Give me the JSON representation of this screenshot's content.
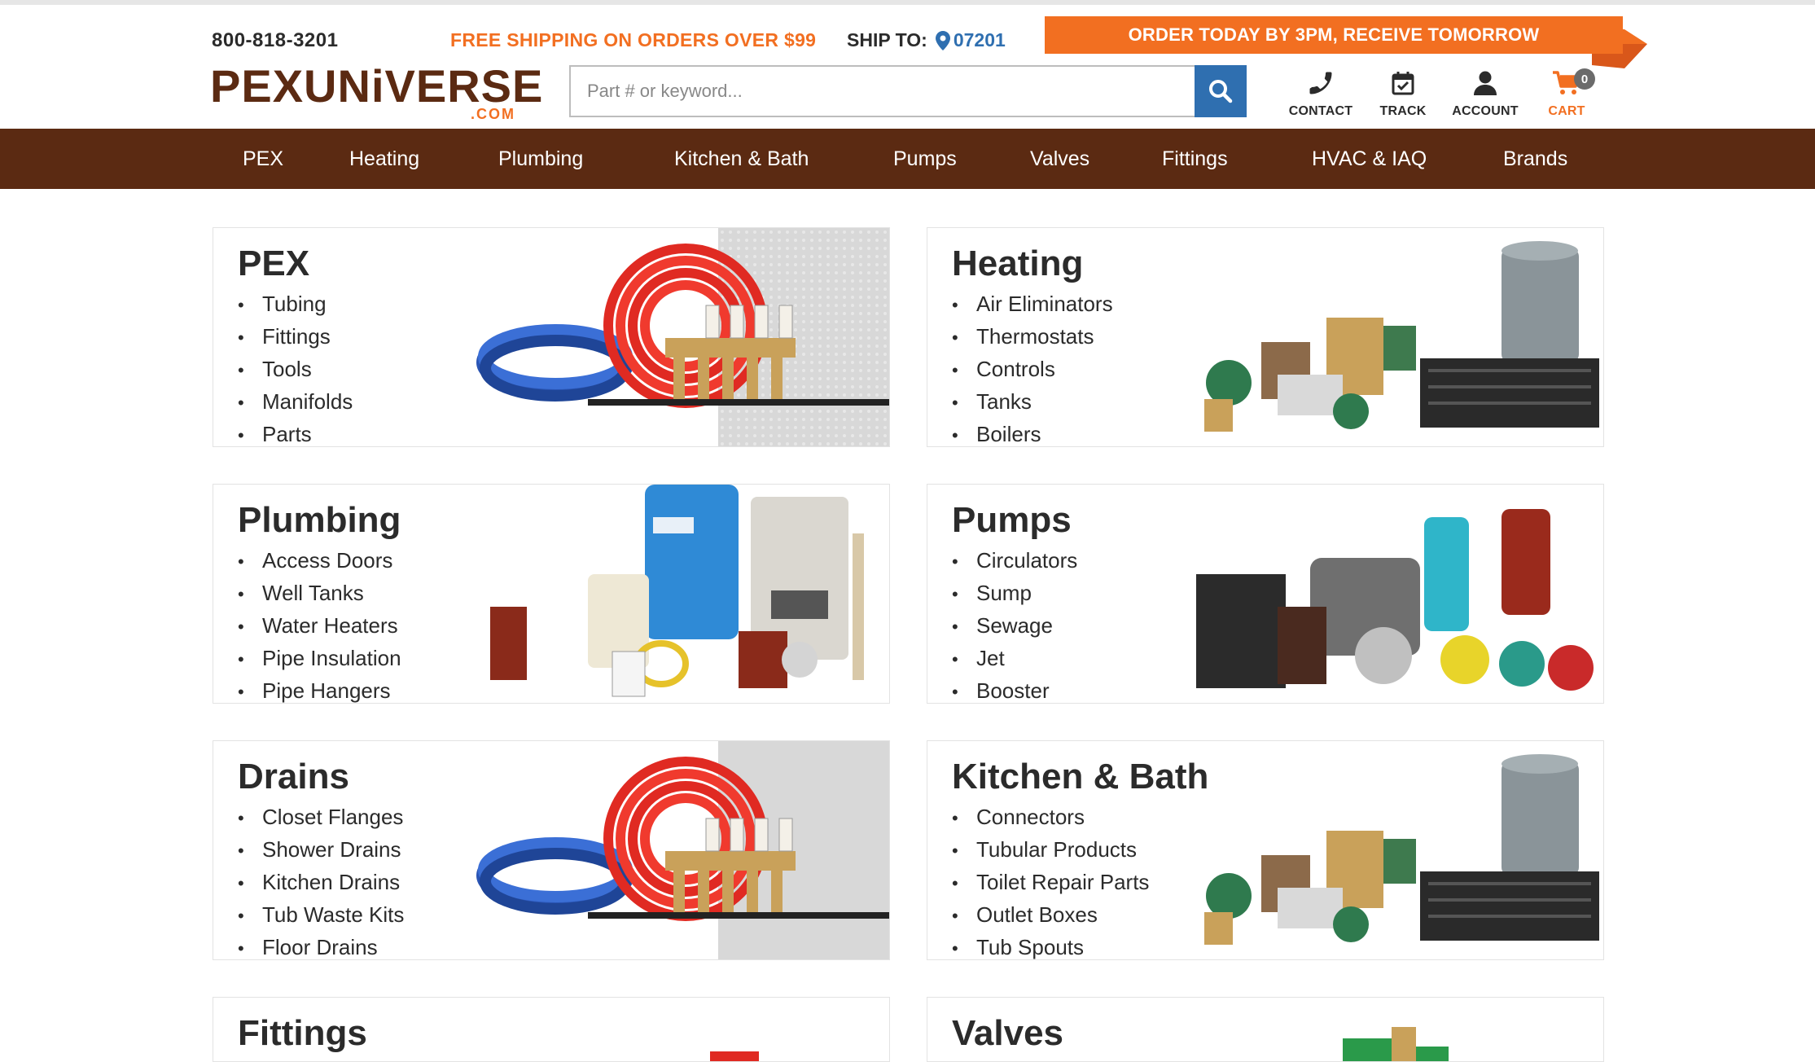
{
  "header": {
    "phone": "800-818-3201",
    "free_shipping": "FREE SHIPPING ON ORDERS OVER $99",
    "ship_to_label": "SHIP TO:",
    "ship_to_zip": "07201",
    "order_banner": "ORDER TODAY BY 3PM, RECEIVE TOMORROW",
    "logo_main": "PEXUNiVERSE",
    "logo_suffix": ".COM",
    "search_placeholder": "Part # or keyword...",
    "icons": {
      "contact": "CONTACT",
      "track": "TRACK",
      "account": "ACCOUNT",
      "cart": "CART",
      "cart_count": "0"
    }
  },
  "nav": [
    "PEX",
    "Heating",
    "Plumbing",
    "Kitchen & Bath",
    "Pumps",
    "Valves",
    "Fittings",
    "HVAC & IAQ",
    "Brands"
  ],
  "categories": [
    {
      "title": "PEX",
      "items": [
        "Tubing",
        "Fittings",
        "Tools",
        "Manifolds",
        "Parts"
      ],
      "art": "pex-tubing-image"
    },
    {
      "title": "Heating",
      "items": [
        "Air Eliminators",
        "Thermostats",
        "Controls",
        "Tanks",
        "Boilers"
      ],
      "art": "heating-products-image"
    },
    {
      "title": "Plumbing",
      "items": [
        "Access Doors",
        "Well Tanks",
        "Water Heaters",
        "Pipe Insulation",
        "Pipe Hangers"
      ],
      "art": "plumbing-products-image"
    },
    {
      "title": "Pumps",
      "items": [
        "Circulators",
        "Sump",
        "Sewage",
        "Jet",
        "Booster"
      ],
      "art": "pumps-image"
    },
    {
      "title": "Drains",
      "items": [
        "Closet Flanges",
        "Shower Drains",
        "Kitchen Drains",
        "Tub Waste Kits",
        "Floor Drains"
      ],
      "art": "pex-tubing-image"
    },
    {
      "title": "Kitchen & Bath",
      "items": [
        "Connectors",
        "Tubular Products",
        "Toilet Repair Parts",
        "Outlet Boxes",
        "Tub Spouts"
      ],
      "art": "heating-products-image"
    },
    {
      "title": "Fittings",
      "items": [],
      "art": "fittings-image"
    },
    {
      "title": "Valves",
      "items": [],
      "art": "valves-image"
    }
  ],
  "colors": {
    "brand_brown": "#5b2a12",
    "brand_orange": "#f26f21",
    "link_blue": "#2f6fb0"
  }
}
